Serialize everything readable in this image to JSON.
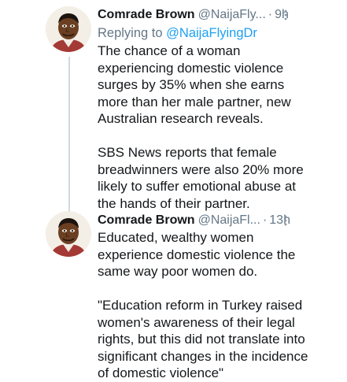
{
  "tweets": [
    {
      "display_name": "Comrade Brown",
      "handle": "@NaijaFly...",
      "separator": "·",
      "time": "9h",
      "replying_prefix": "Replying to",
      "replying_mention": "@NaijaFlyingDr",
      "paragraphs": [
        "The chance of a woman\nexperiencing domestic violence\nsurges by 35% when she earns\nmore than her male partner, new\nAustralian research reveals.",
        "SBS News reports that female\nbreadwinners were also 20% more\nlikely to suffer emotional abuse at\nthe hands of their partner."
      ],
      "icons": {
        "avatar": "profile-avatar",
        "more": "more-vertical-icon"
      }
    },
    {
      "display_name": "Comrade Brown",
      "handle": "@NaijaFl...",
      "separator": "·",
      "time": "13h",
      "paragraphs": [
        "Educated, wealthy women\nexperience domestic violence the\nsame way poor women do.",
        "\"Education reform in Turkey raised\nwomen's awareness of their legal\nrights, but this did not translate into\nsignificant changes in the incidence\nof domestic violence\""
      ],
      "icons": {
        "avatar": "profile-avatar",
        "more": "more-vertical-icon"
      }
    }
  ],
  "colors": {
    "text": "#14171a",
    "secondary": "#657786",
    "link": "#1da1f2",
    "thread_line": "#cfd9de"
  }
}
